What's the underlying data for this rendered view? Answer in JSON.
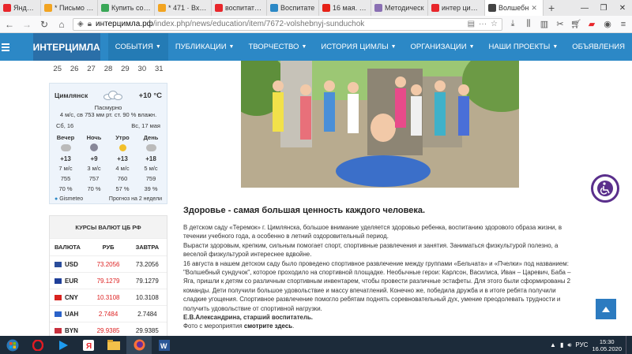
{
  "browser": {
    "tabs": [
      {
        "title": "Яндекс",
        "icon": "yandex-icon",
        "color": "#e8262b"
      },
      {
        "title": "* Письмо «Го",
        "icon": "mail-icon",
        "color": "#f2a421"
      },
      {
        "title": "Купить сокол",
        "icon": "market-icon",
        "color": "#3aa757"
      },
      {
        "title": "* 471 · Входящ",
        "icon": "mail-icon",
        "color": "#f2a421"
      },
      {
        "title": "воспитатели",
        "icon": "yandex-icon",
        "color": "#e8262b"
      },
      {
        "title": "Воспитате",
        "icon": "site-icon",
        "color": "#2c88c6"
      },
      {
        "title": "16 мая. РС",
        "icon": "youtube-icon",
        "color": "#e62117"
      },
      {
        "title": "Методическ",
        "icon": "doc-icon",
        "color": "#8a6fb3"
      },
      {
        "title": "интер цимла",
        "icon": "yandex-icon",
        "color": "#e8262b"
      },
      {
        "title": "Волшебн",
        "icon": "site-icon",
        "color": "#444444",
        "active": true
      }
    ],
    "url": {
      "domain": "интерцимла.рф",
      "path": "/index.php/news/education/item/7672-volshebnyj-sunduchok"
    }
  },
  "site": {
    "logo": "ИНТЕРЦИМЛА",
    "menu": [
      {
        "label": "СОБЫТИЯ",
        "dropdown": true,
        "active": true
      },
      {
        "label": "ПУБЛИКАЦИИ",
        "dropdown": true
      },
      {
        "label": "ТВОРЧЕСТВО",
        "dropdown": true
      },
      {
        "label": "ИСТОРИЯ ЦИМЛЫ",
        "dropdown": true
      },
      {
        "label": "ОРГАНИЗАЦИИ",
        "dropdown": true
      },
      {
        "label": "НАШИ ПРОЕКТЫ",
        "dropdown": true
      },
      {
        "label": "ОБЪЯВЛЕНИЯ",
        "dropdown": false
      }
    ]
  },
  "calendar": {
    "days": [
      "25",
      "26",
      "27",
      "28",
      "29",
      "30",
      "31"
    ]
  },
  "weather": {
    "city": "Цимлянск",
    "temp": "+10 °C",
    "desc1": "Пасмурно",
    "desc2": "4 м/с, св   753 мм рт. ст.   90 % влажн.",
    "date_left": "Сб, 16",
    "date_right": "Вс, 17 мая",
    "forecast": [
      {
        "period": "Вечер",
        "icon": "cloud",
        "temp": "+13",
        "wind": "7 м/с",
        "pressure": "755",
        "humidity": "70 %"
      },
      {
        "period": "Ночь",
        "icon": "moon",
        "temp": "+9",
        "wind": "3 м/с",
        "pressure": "757",
        "humidity": "70 %"
      },
      {
        "period": "Утро",
        "icon": "sun",
        "temp": "+13",
        "wind": "4 м/с",
        "pressure": "760",
        "humidity": "57 %"
      },
      {
        "period": "День",
        "icon": "cloud",
        "temp": "+18",
        "wind": "5 м/с",
        "pressure": "759",
        "humidity": "39 %"
      }
    ],
    "provider": "Gismeteo",
    "forecast_link": "Прогноз на 2 недели"
  },
  "rates": {
    "title": "КУРСЫ ВАЛЮТ ЦБ РФ",
    "headers": [
      "ВАЛЮТА",
      "РУБ",
      "ЗАВТРА"
    ],
    "rows": [
      {
        "code": "USD",
        "flag": "#2a4d9b",
        "today": "73.2056",
        "tomorrow": "73.2056"
      },
      {
        "code": "EUR",
        "flag": "#1f3f99",
        "today": "79.1279",
        "tomorrow": "79.1279"
      },
      {
        "code": "CNY",
        "flag": "#d8231f",
        "today": "10.3108",
        "tomorrow": "10.3108"
      },
      {
        "code": "UAH",
        "flag": "#2a62c9",
        "today": "2.7484",
        "tomorrow": "2.7484"
      },
      {
        "code": "BYN",
        "flag": "#c8313e",
        "today": "29.9385",
        "tomorrow": "29.9385"
      }
    ]
  },
  "article": {
    "headline": "Здоровье - самая большая ценность каждого человека.",
    "paragraphs": [
      "В детском саду «Теремок» г. Цимлянска, большое внимание уделяется здоровью ребенка, воспитанию здорового образа жизни, в течении учебного года, а особенно в летний оздоровительный период.",
      "Вырасти здоровым, крепким, сильным помогает спорт, спортивные развлечения и занятия. Заниматься физкультурой полезно, а веселой физкультурой интереснее вдвойне.",
      "16 августа в нашем детском саду было проведено спортивное развлечение между группами «Бельчата» и «Пчелки» под названием: \"Волшебный сундучок\", которое проходило на спортивной площадке. Необычные герои: Карлсон, Василиса, Иван – Царевич, Баба – Яга, пришли к детям со различным спортивным инвентарем, чтобы провести различные эстафеты. Для этого были сформированы 2 команды. Дети получили большое удовольствие и массу впечатлений. Конечно же, победила дружба и в итоге ребята получили сладкие угощения. Спортивное развлечение помогло ребятам поднять соревновательный дух, умение преодолевать трудности и получить удовольствие от спортивной нагрузки."
    ],
    "signature": "Е.В.Александрина, старший воспитатель.",
    "photo_text": "Фото с мероприятия ",
    "photo_link": "смотрите здесь",
    "photo_end": "."
  },
  "taskbar": {
    "lang": "РУС",
    "time": "15:30",
    "date": "16.05.2020"
  }
}
